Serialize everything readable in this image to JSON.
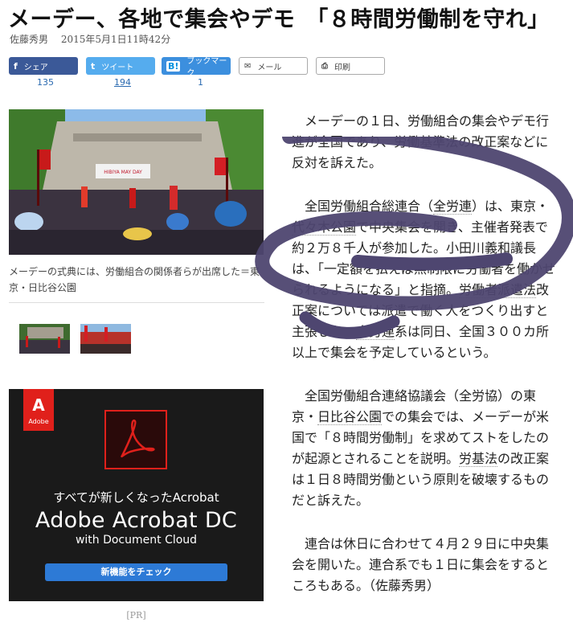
{
  "headline": "メーデー、各地で集会やデモ　「８時間労働制を守れ」",
  "author": "佐藤秀男",
  "timestamp": "2015年5月1日11時42分",
  "share": {
    "facebook": {
      "icon": "f",
      "label": "シェア",
      "count": "135"
    },
    "twitter": {
      "icon": "t",
      "label": "ツイート",
      "count": "194"
    },
    "hatena": {
      "icon": "B!",
      "label": "ブックマーク",
      "count": "1"
    },
    "mail": {
      "label": "メール"
    },
    "print": {
      "label": "印刷"
    }
  },
  "photo": {
    "banner": "HIBIYA MAY DAY",
    "caption": "メーデーの式典には、労働組合の関係者らが出席した＝東京・日比谷公園"
  },
  "ad": {
    "brand": "Adobe",
    "line1": "すべてが新しくなったAcrobat",
    "line2": "Adobe Acrobat DC",
    "line3": "with Document Cloud",
    "button": "新機能をチェック",
    "pr_label": "[PR]"
  },
  "article": {
    "p1": "メーデーの１日、労働組合の集会やデモ行進が全国であり、労働基準法の改正案などに反対を訴えた。",
    "p2_a": "全国労働組合総連合（",
    "p2_kw1": "全労連",
    "p2_b": "）は、東京・",
    "p2_kw2": "代々木公園",
    "p2_c": "で中央集会を開き、主催者発表で約２万８千人が参加した。小田川義和議長は、",
    "p2_d": "「一定額を払えば無制限に労働者を働かせられるようになる」と指摘。",
    "p2_kw3": "労働者派遣法",
    "p2_e": "改正案については派遣で働く人をつくり出すと主張した。",
    "p2_kw4": "全労連",
    "p2_f": "系は同日、全国３００カ所以上で集会を予定しているという。",
    "p3_a": "全国労働組合連絡協議会（全労協）の東京・",
    "p3_kw1": "日比谷公園",
    "p3_b": "での集会では、メーデーが米国で「８時間労働制」を求めてストをしたのが起源とされることを説明。",
    "p3_kw2": "労基法",
    "p3_c": "の改正案は１日８時間労働という原則を破壊するものだと訴えた。",
    "p4": "連合は休日に合わせて４月２９日に中央集会を開いた。連合系でも１日に集会をするところもある。（佐藤秀男）"
  },
  "colors": {
    "scribble": "#4e4670",
    "facebook": "#3b5998",
    "twitter": "#55acee",
    "hatena": "#3c8fde"
  }
}
